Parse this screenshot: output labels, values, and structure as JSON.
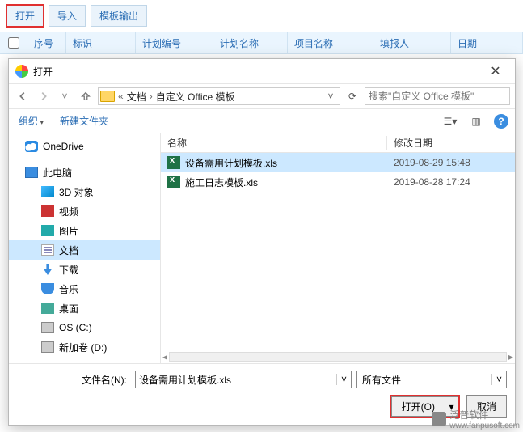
{
  "toolbar": {
    "open": "打开",
    "import": "导入",
    "template_out": "模板输出"
  },
  "tableHeader": {
    "seq": "序号",
    "label": "标识",
    "plan_no": "计划编号",
    "plan_name": "计划名称",
    "project_name": "项目名称",
    "reporter": "填报人",
    "date": "日期"
  },
  "dialog": {
    "title": "打开",
    "breadcrumb": {
      "a": "文档",
      "b": "自定义 Office 模板"
    },
    "searchPlaceholder": "搜索\"自定义 Office 模板\"",
    "organize": "组织",
    "newFolder": "新建文件夹",
    "tree": {
      "onedrive": "OneDrive",
      "thispc": "此电脑",
      "threeD": "3D 对象",
      "video": "视频",
      "pictures": "图片",
      "docs": "文档",
      "downloads": "下载",
      "music": "音乐",
      "desktop": "桌面",
      "osc": "OS (C:)",
      "newvol": "新加卷 (D:)"
    },
    "columns": {
      "name": "名称",
      "modified": "修改日期"
    },
    "files": [
      {
        "name": "设备需用计划模板.xls",
        "date": "2019-08-29 15:48"
      },
      {
        "name": "施工日志模板.xls",
        "date": "2019-08-28 17:24"
      }
    ],
    "filenameLabel": "文件名(N):",
    "filenameValue": "设备需用计划模板.xls",
    "filterLabel": "所有文件",
    "openBtn": "打开(O)",
    "cancelBtn": "取消"
  },
  "watermark": {
    "brand": "泛普软件",
    "url": "www.fanpusoft.com"
  }
}
